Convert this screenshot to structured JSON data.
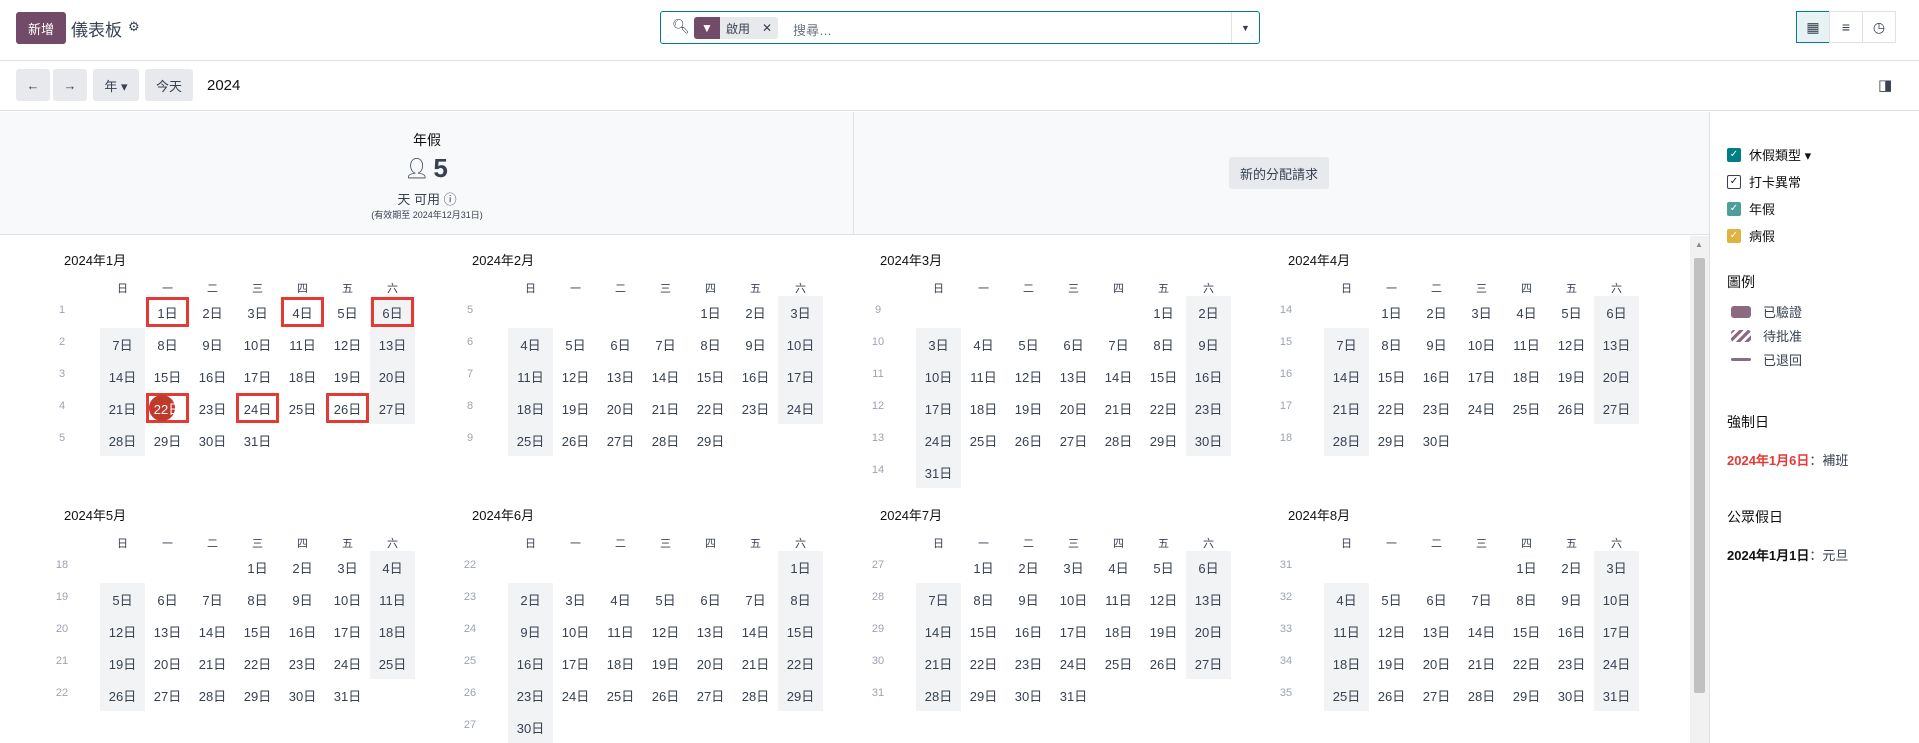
{
  "header": {
    "new_label": "新增",
    "breadcrumb": "儀表板",
    "search_facet": "啟用",
    "search_placeholder": "搜尋…"
  },
  "toolbar": {
    "scale_label": "年 ▾",
    "today_label": "今天",
    "year": "2024"
  },
  "summary": {
    "title": "年假",
    "count": "5",
    "available": "天 可用",
    "valid_until": "(有效期至 2024年12月31日)",
    "new_allocation": "新的分配請求"
  },
  "weekdays": [
    "日",
    "一",
    "二",
    "三",
    "四",
    "五",
    "六"
  ],
  "colors": {
    "accent": "#714b67",
    "teal": "#017e84",
    "highlight": "#e53935",
    "annual": "#4e9f9b",
    "sick": "#e0b341"
  },
  "months": [
    {
      "title": "2024年1月",
      "weeks": [
        1,
        2,
        3,
        4,
        5
      ],
      "days": [
        "",
        "1日",
        "2日",
        "3日",
        "4日",
        "5日",
        "6日",
        "7日",
        "8日",
        "9日",
        "10日",
        "11日",
        "12日",
        "13日",
        "14日",
        "15日",
        "16日",
        "17日",
        "18日",
        "19日",
        "20日",
        "21日",
        "22日",
        "23日",
        "24日",
        "25日",
        "26日",
        "27日",
        "28日",
        "29日",
        "30日",
        "31日"
      ]
    },
    {
      "title": "2024年2月",
      "weeks": [
        5,
        6,
        7,
        8,
        9
      ],
      "days": [
        "",
        "",
        "",
        "",
        "1日",
        "2日",
        "3日",
        "4日",
        "5日",
        "6日",
        "7日",
        "8日",
        "9日",
        "10日",
        "11日",
        "12日",
        "13日",
        "14日",
        "15日",
        "16日",
        "17日",
        "18日",
        "19日",
        "20日",
        "21日",
        "22日",
        "23日",
        "24日",
        "25日",
        "26日",
        "27日",
        "28日",
        "29日"
      ]
    },
    {
      "title": "2024年3月",
      "weeks": [
        9,
        10,
        11,
        12,
        13,
        14
      ],
      "days": [
        "",
        "",
        "",
        "",
        "",
        "1日",
        "2日",
        "3日",
        "4日",
        "5日",
        "6日",
        "7日",
        "8日",
        "9日",
        "10日",
        "11日",
        "12日",
        "13日",
        "14日",
        "15日",
        "16日",
        "17日",
        "18日",
        "19日",
        "20日",
        "21日",
        "22日",
        "23日",
        "24日",
        "25日",
        "26日",
        "27日",
        "28日",
        "29日",
        "30日",
        "31日"
      ]
    },
    {
      "title": "2024年4月",
      "weeks": [
        14,
        15,
        16,
        17,
        18
      ],
      "days": [
        "",
        "1日",
        "2日",
        "3日",
        "4日",
        "5日",
        "6日",
        "7日",
        "8日",
        "9日",
        "10日",
        "11日",
        "12日",
        "13日",
        "14日",
        "15日",
        "16日",
        "17日",
        "18日",
        "19日",
        "20日",
        "21日",
        "22日",
        "23日",
        "24日",
        "25日",
        "26日",
        "27日",
        "28日",
        "29日",
        "30日"
      ]
    },
    {
      "title": "2024年5月",
      "weeks": [
        18,
        19,
        20,
        21,
        22
      ],
      "days": [
        "",
        "",
        "",
        "1日",
        "2日",
        "3日",
        "4日",
        "5日",
        "6日",
        "7日",
        "8日",
        "9日",
        "10日",
        "11日",
        "12日",
        "13日",
        "14日",
        "15日",
        "16日",
        "17日",
        "18日",
        "19日",
        "20日",
        "21日",
        "22日",
        "23日",
        "24日",
        "25日",
        "26日",
        "27日",
        "28日",
        "29日",
        "30日",
        "31日"
      ]
    },
    {
      "title": "2024年6月",
      "weeks": [
        22,
        23,
        24,
        25,
        26,
        27
      ],
      "days": [
        "",
        "",
        "",
        "",
        "",
        "",
        "1日",
        "2日",
        "3日",
        "4日",
        "5日",
        "6日",
        "7日",
        "8日",
        "9日",
        "10日",
        "11日",
        "12日",
        "13日",
        "14日",
        "15日",
        "16日",
        "17日",
        "18日",
        "19日",
        "20日",
        "21日",
        "22日",
        "23日",
        "24日",
        "25日",
        "26日",
        "27日",
        "28日",
        "29日",
        "30日"
      ]
    },
    {
      "title": "2024年7月",
      "weeks": [
        27,
        28,
        29,
        30,
        31
      ],
      "days": [
        "",
        "1日",
        "2日",
        "3日",
        "4日",
        "5日",
        "6日",
        "7日",
        "8日",
        "9日",
        "10日",
        "11日",
        "12日",
        "13日",
        "14日",
        "15日",
        "16日",
        "17日",
        "18日",
        "19日",
        "20日",
        "21日",
        "22日",
        "23日",
        "24日",
        "25日",
        "26日",
        "27日",
        "28日",
        "29日",
        "30日",
        "31日"
      ]
    },
    {
      "title": "2024年8月",
      "weeks": [
        31,
        32,
        33,
        34,
        35
      ],
      "days": [
        "",
        "",
        "",
        "",
        "1日",
        "2日",
        "3日",
        "4日",
        "5日",
        "6日",
        "7日",
        "8日",
        "9日",
        "10日",
        "11日",
        "12日",
        "13日",
        "14日",
        "15日",
        "16日",
        "17日",
        "18日",
        "19日",
        "20日",
        "21日",
        "22日",
        "23日",
        "24日",
        "25日",
        "26日",
        "27日",
        "28日",
        "29日",
        "30日",
        "31日"
      ]
    }
  ],
  "marked_days_jan": [
    "1日",
    "4日",
    "6日",
    "22日",
    "24日",
    "26日"
  ],
  "today_day": "22日",
  "sidebar": {
    "filters": [
      {
        "label": "休假類型 ▾",
        "color": "#017e84"
      },
      {
        "label": "打卡異常",
        "color": "#ffffff"
      },
      {
        "label": "年假",
        "color": "#4e9f9b"
      },
      {
        "label": "病假",
        "color": "#e0b341"
      }
    ],
    "legend_title": "圖例",
    "legend": [
      {
        "label": "已驗證"
      },
      {
        "label": "待批准"
      },
      {
        "label": "已退回"
      }
    ],
    "mandatory_title": "強制日",
    "mandatory_date": "2024年1月6日",
    "mandatory_name": "：補班",
    "holiday_title": "公眾假日",
    "holiday_date": "2024年1月1日",
    "holiday_name": "：元旦"
  }
}
